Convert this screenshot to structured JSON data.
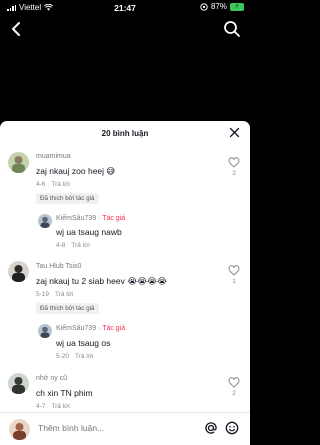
{
  "status": {
    "carrier": "Viettel",
    "time": "21:47",
    "battery": "87%"
  },
  "nav": {
    "back_icon": "chevron-left-icon",
    "search_icon": "search-icon"
  },
  "sheet": {
    "title": "20 bình luận"
  },
  "comments": [
    {
      "name": "muamimua",
      "text": "zaj nkauj zoo heej 😅",
      "date": "4-6",
      "reply": "Trả lời",
      "likes": "2",
      "liked_by_author": "Đã thích bởi tác giả",
      "replies": [
        {
          "name": "KiếmSâu739",
          "author_tag": "· Tác giả",
          "text": "wj ua tsaug nawb",
          "date": "4-8",
          "reply": "Trả lời"
        }
      ]
    },
    {
      "name": "Tau Hlub Tsis0",
      "text": "zaj nkauj tu 2 siab heev 😭😭😭😭",
      "date": "5-19",
      "reply": "Trả lời",
      "likes": "1",
      "liked_by_author": "Đã thích bởi tác giả",
      "replies": [
        {
          "name": "KiếmSâu739",
          "author_tag": "· Tác giả",
          "text": "wj ua tsaug os",
          "date": "5-20",
          "reply": "Trả lời"
        }
      ]
    },
    {
      "name": "nhớ ny cũ",
      "text": "ch xin TN phim",
      "date": "4-7",
      "reply": "Trả lời",
      "likes": "2"
    }
  ],
  "input": {
    "placeholder": "Thêm bình luận..."
  }
}
